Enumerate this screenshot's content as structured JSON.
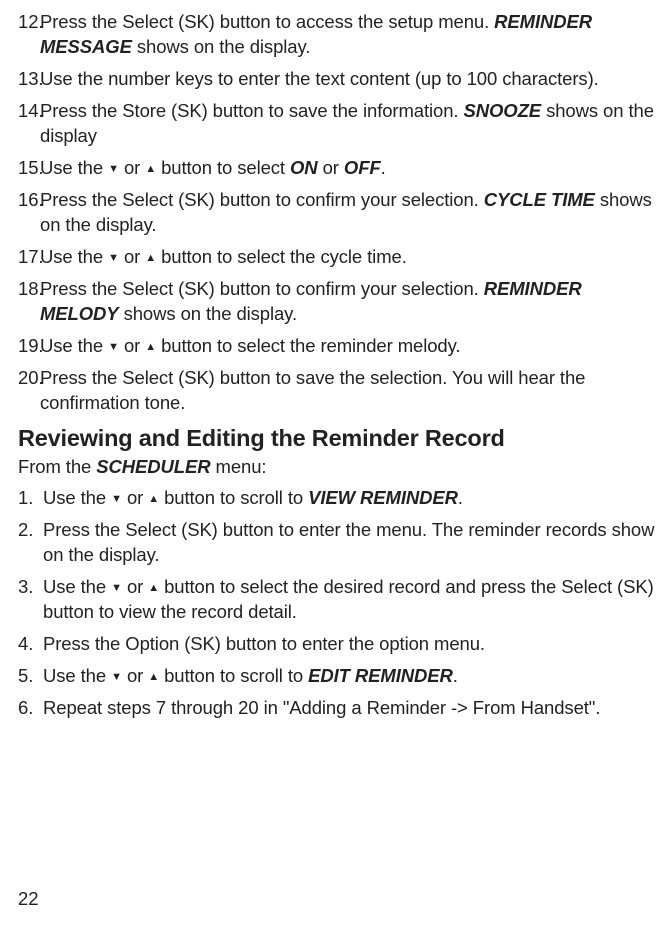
{
  "glyphs": {
    "down": "▼",
    "up": "▲"
  },
  "listA": [
    {
      "n": "12.",
      "pre": "Press the Select (SK) button to access the setup menu. ",
      "em": "REMINDER MESSAGE",
      "post": " shows on the display."
    },
    {
      "n": "13.",
      "pre": "Use the number keys to enter the text content (up to 100 characters).",
      "em": "",
      "post": ""
    },
    {
      "n": "14.",
      "pre": "Press the Store (SK) button to save the information. ",
      "em": "SNOOZE",
      "post": " shows on the display"
    },
    {
      "n": "15.",
      "arrows": true,
      "preA": "Use the ",
      "midA": " or ",
      "postA": " button to select ",
      "em1": "ON",
      "between": " or ",
      "em2": "OFF",
      "tail": "."
    },
    {
      "n": "16.",
      "pre": "Press the Select (SK) button to confirm your selection. ",
      "em": "CYCLE TIME",
      "post": " shows on the display."
    },
    {
      "n": "17.",
      "arrows": true,
      "preA": "Use the ",
      "midA": " or ",
      "postA": " button to select the cycle time.",
      "em1": "",
      "between": "",
      "em2": "",
      "tail": ""
    },
    {
      "n": "18.",
      "pre": "Press the Select (SK) button to confirm your selection. ",
      "em": "REMINDER MELODY",
      "post": " shows on the display."
    },
    {
      "n": "19.",
      "arrows": true,
      "preA": "Use the ",
      "midA": " or ",
      "postA": " button to select the reminder melody.",
      "em1": "",
      "between": "",
      "em2": "",
      "tail": ""
    },
    {
      "n": "20.",
      "pre": "Press the Select (SK) button to save the selection. You will hear the confirmation tone.",
      "em": "",
      "post": ""
    }
  ],
  "heading": "Reviewing and Editing the Reminder Record",
  "intro": {
    "pre": "From the ",
    "em": "SCHEDULER",
    "post": " menu:"
  },
  "listB": [
    {
      "n": "1.",
      "arrows": true,
      "preA": "Use the ",
      "midA": " or ",
      "postA": " button to scroll to ",
      "em1": "VIEW REMINDER",
      "between": "",
      "em2": "",
      "tail": "."
    },
    {
      "n": "2.",
      "pre": "Press the Select (SK) button to enter the menu. The reminder records show on the display.",
      "em": "",
      "post": ""
    },
    {
      "n": "3.",
      "arrows": true,
      "preA": "Use the ",
      "midA": " or ",
      "postA": " button to select the desired record and press the Select (SK) button to view the record detail.",
      "em1": "",
      "between": "",
      "em2": "",
      "tail": ""
    },
    {
      "n": "4.",
      "pre": "Press the Option (SK) button to enter the option menu.",
      "em": "",
      "post": ""
    },
    {
      "n": "5.",
      "arrows": true,
      "preA": "Use the ",
      "midA": " or ",
      "postA": " button to scroll to ",
      "em1": "EDIT REMINDER",
      "between": "",
      "em2": "",
      "tail": "."
    },
    {
      "n": "6.",
      "pre": "Repeat steps 7 through 20 in \"Adding a Reminder -> From Handset\".",
      "em": "",
      "post": ""
    }
  ],
  "pageNumber": "22"
}
